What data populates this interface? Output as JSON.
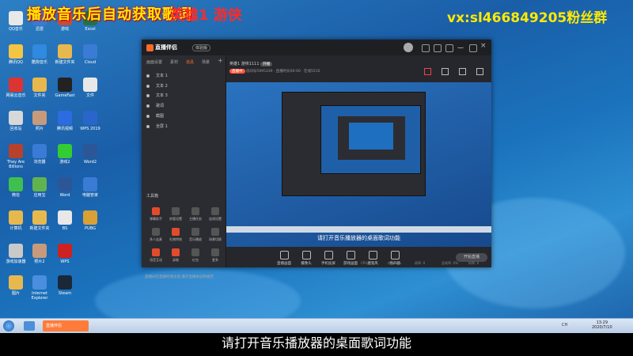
{
  "overlay": {
    "left_text": "播放音乐后自动获取歌词",
    "mid_text": "英雄1 游侠",
    "right_text": "vx:sl466849205粉丝群"
  },
  "desktop": {
    "icons": [
      {
        "label": "QQ音乐",
        "color": "#e8e8e8"
      },
      {
        "label": "腾讯QQ",
        "color": "#f4c542"
      },
      {
        "label": "网易云音乐",
        "color": "#d33"
      },
      {
        "label": "回收站",
        "color": "#d8d8d8"
      },
      {
        "label": "They Are Billions",
        "color": "#b8412c"
      },
      {
        "label": "微信",
        "color": "#3fbf4f"
      },
      {
        "label": "计算机",
        "color": "#e7b84d"
      },
      {
        "label": "游戏加速器",
        "color": "#c9c9c9"
      },
      {
        "label": "图片",
        "color": "#e7b84d"
      },
      {
        "label": "迅雷",
        "color": "#3a7bd5"
      },
      {
        "label": "酷狗音乐",
        "color": "#2f8ae0"
      },
      {
        "label": "文件夹",
        "color": "#e7b84d"
      },
      {
        "label": "照片",
        "color": "#c69a7b"
      },
      {
        "label": "浏览器",
        "color": "#3a7bd5"
      },
      {
        "label": "应用宝",
        "color": "#61b34f"
      },
      {
        "label": "新建文件夹",
        "color": "#e7b84d"
      },
      {
        "label": "照片2",
        "color": "#c69a7b"
      },
      {
        "label": "Internet Explorer",
        "color": "#4a8ee0"
      },
      {
        "label": "游戏",
        "color": "#c94b3a"
      },
      {
        "label": "新建文件夹",
        "color": "#e7b84d"
      },
      {
        "label": "GameFast",
        "color": "#222"
      },
      {
        "label": "腾讯视频",
        "color": "#2c6be0"
      },
      {
        "label": "游戏2",
        "color": "#3c3"
      },
      {
        "label": "Word",
        "color": "#2b5797"
      },
      {
        "label": "BS",
        "color": "#e8e8e8"
      },
      {
        "label": "WPS",
        "color": "#c22"
      },
      {
        "label": "Steam",
        "color": "#1b2838"
      },
      {
        "label": "Excel",
        "color": "#217346"
      },
      {
        "label": "Cloud",
        "color": "#3a7bd5"
      },
      {
        "label": "文件",
        "color": "#e8e8e8"
      },
      {
        "label": "WPS 2019",
        "color": "#2a66c9"
      },
      {
        "label": "Word2",
        "color": "#2b5797"
      },
      {
        "label": "电脑管家",
        "color": "#3a7bd5"
      },
      {
        "label": "PUBG",
        "color": "#d8a035"
      }
    ]
  },
  "app": {
    "logo": "直播伴侣",
    "version": "体验版",
    "left_tabs": [
      "画面设置",
      "素材",
      "道具",
      "场景"
    ],
    "sources": [
      "文本 1",
      "文本 2",
      "文本 3",
      "歌词",
      "截图",
      "全屏 1"
    ],
    "tools_title": "工具箱",
    "tools": [
      {
        "label": "弹幕助手",
        "color": "#e24b2c"
      },
      {
        "label": "房管设置",
        "color": "#555"
      },
      {
        "label": "主播任务",
        "color": "#555"
      },
      {
        "label": "连线设置",
        "color": "#555"
      },
      {
        "label": "多人连麦",
        "color": "#555"
      },
      {
        "label": "礼物特效",
        "color": "#e24b2c"
      },
      {
        "label": "音乐播放",
        "color": "#555"
      },
      {
        "label": "场景切换",
        "color": "#555"
      },
      {
        "label": "语音互动",
        "color": "#e24b2c"
      },
      {
        "label": "录制",
        "color": "#e24b2c"
      },
      {
        "label": "红包",
        "color": "#555"
      },
      {
        "label": "更多",
        "color": "#555"
      }
    ],
    "warning": "直播间在直播时请注意,遵守直播协议和规范",
    "room": {
      "name": "英雄1 游侠1111",
      "tag": "开播",
      "info": "房间号5995339 · 直播时长00:00 · 在线5510",
      "status_btn": "直播中"
    },
    "preview_subtitle": "请打开音乐播放器的桌面歌词功能",
    "controls": [
      "直播画面",
      "摄像头",
      "手机投屏",
      "游戏画面",
      "麦克风",
      "扬声器"
    ],
    "start_button": "开始直播",
    "stats": [
      "CPU: 0%",
      "内存: 0%",
      "帧率: 0",
      "丢帧率: 0%",
      "码率: 0"
    ]
  },
  "taskbar": {
    "app_label": "直播伴侣",
    "clock_time": "13:29",
    "clock_date": "2020/7/10",
    "lang": "CH"
  },
  "subtitle": "请打开音乐播放器的桌面歌词功能"
}
